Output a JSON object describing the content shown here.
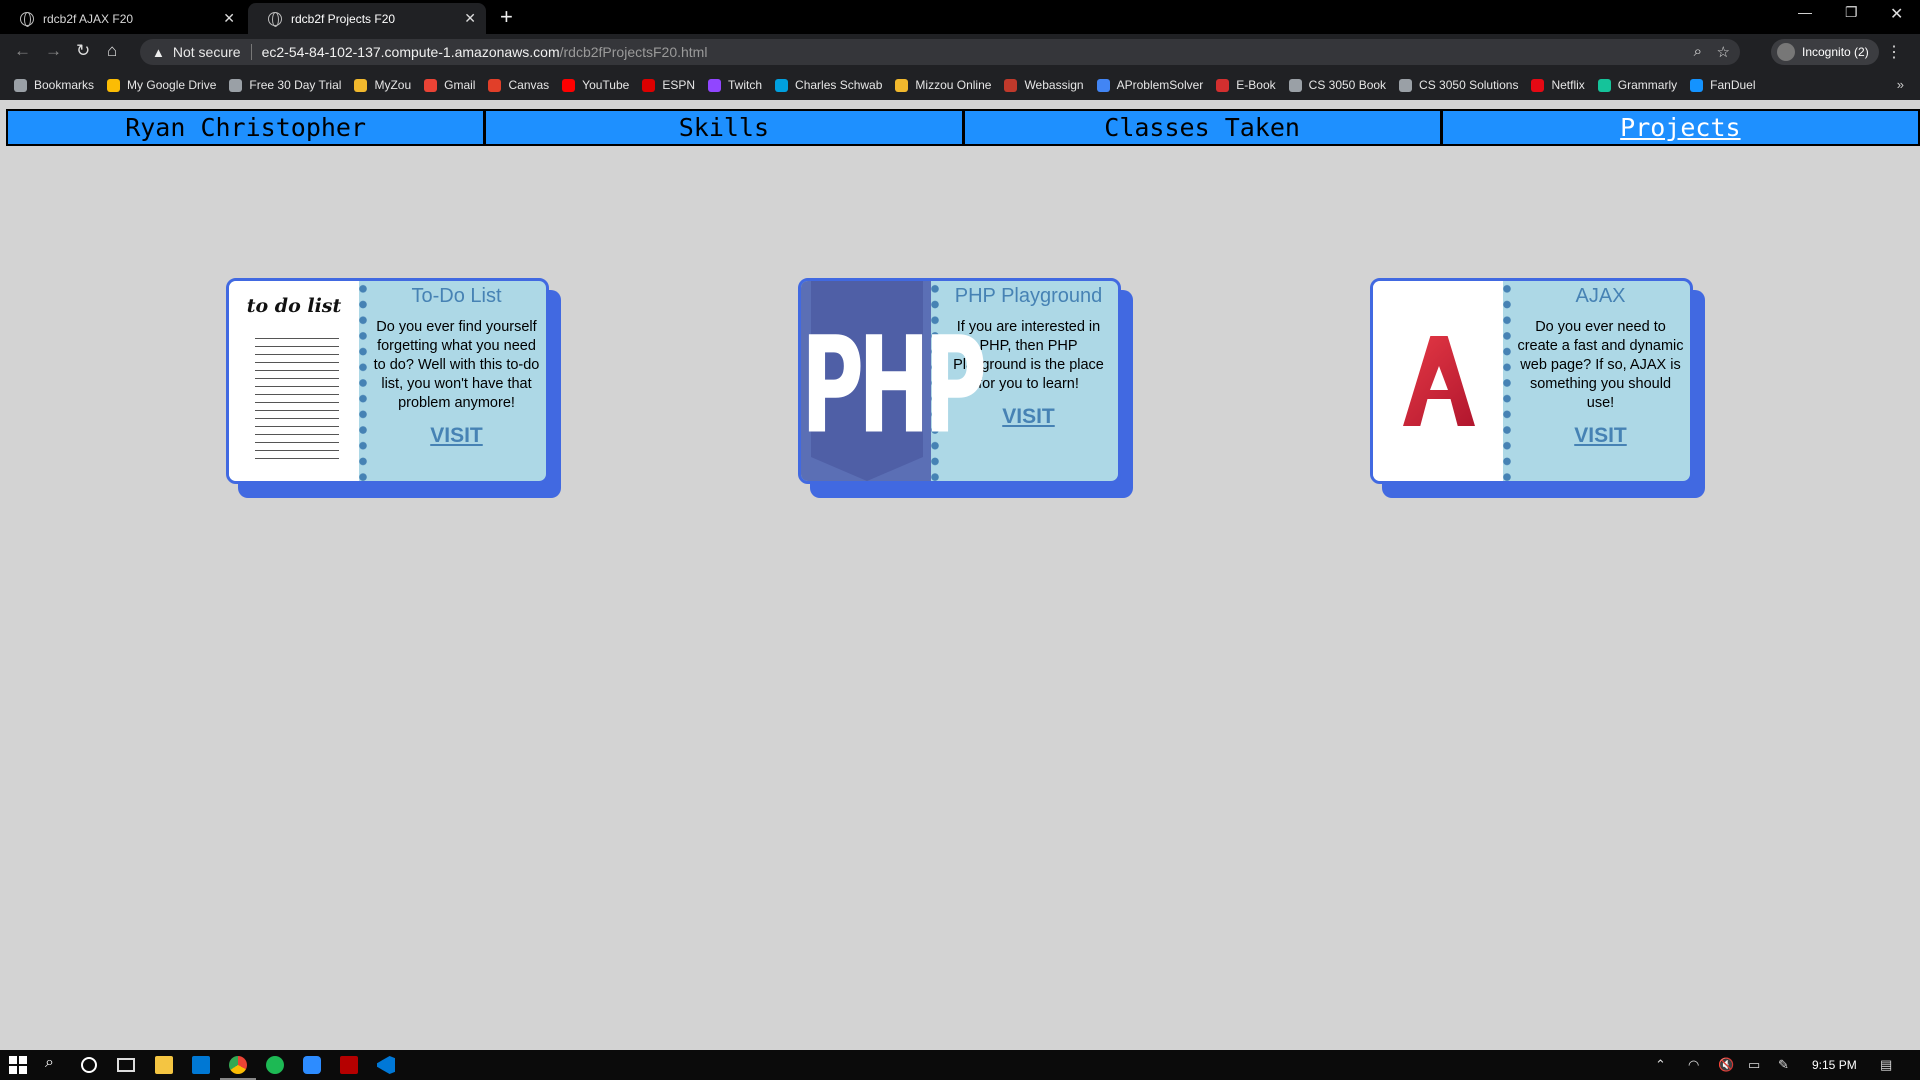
{
  "browser": {
    "tabs": [
      {
        "label": "rdcb2f AJAX F20",
        "active": false
      },
      {
        "label": "rdcb2f Projects F20",
        "active": true
      }
    ],
    "security_label": "Not secure",
    "url_host": "ec2-54-84-102-137.compute-1.amazonaws.com",
    "url_path": "/rdcb2fProjectsF20.html",
    "profile_label": "Incognito (2)",
    "bookmarks": [
      {
        "label": "Bookmarks",
        "icon": "star-icon",
        "color": "#9aa0a6"
      },
      {
        "label": "My Google Drive",
        "icon": "drive-icon",
        "color": "#fbbc04"
      },
      {
        "label": "Free 30 Day Trial",
        "icon": "globe-icon",
        "color": "#9aa0a6"
      },
      {
        "label": "MyZou",
        "icon": "myzou-icon",
        "color": "#f1b82d"
      },
      {
        "label": "Gmail",
        "icon": "gmail-icon",
        "color": "#ea4335"
      },
      {
        "label": "Canvas",
        "icon": "canvas-icon",
        "color": "#e13f29"
      },
      {
        "label": "YouTube",
        "icon": "youtube-icon",
        "color": "#ff0000"
      },
      {
        "label": "ESPN",
        "icon": "espn-icon",
        "color": "#d00"
      },
      {
        "label": "Twitch",
        "icon": "twitch-icon",
        "color": "#9146ff"
      },
      {
        "label": "Charles Schwab",
        "icon": "schwab-icon",
        "color": "#00a0df"
      },
      {
        "label": "Mizzou Online",
        "icon": "mizzou-icon",
        "color": "#f1b82d"
      },
      {
        "label": "Webassign",
        "icon": "webassign-icon",
        "color": "#c0392b"
      },
      {
        "label": "AProblemSolver",
        "icon": "aproblemsolver-icon",
        "color": "#4285f4"
      },
      {
        "label": "E-Book",
        "icon": "ebook-icon",
        "color": "#d32f2f"
      },
      {
        "label": "CS 3050 Book",
        "icon": "globe-icon",
        "color": "#9aa0a6"
      },
      {
        "label": "CS 3050 Solutions",
        "icon": "wordpress-icon",
        "color": "#9aa0a6"
      },
      {
        "label": "Netflix",
        "icon": "netflix-icon",
        "color": "#e50914"
      },
      {
        "label": "Grammarly",
        "icon": "grammarly-icon",
        "color": "#15c39a"
      },
      {
        "label": "FanDuel",
        "icon": "fanduel-icon",
        "color": "#1493ff"
      }
    ]
  },
  "nav": {
    "items": [
      {
        "label": "Ryan Christopher",
        "active": false
      },
      {
        "label": "Skills",
        "active": false
      },
      {
        "label": "Classes Taken",
        "active": false
      },
      {
        "label": "Projects",
        "active": true
      }
    ]
  },
  "projects": [
    {
      "title": "To-Do List",
      "description": "Do you ever find yourself forgetting what you need to do? Well with this to-do list, you won't have that problem anymore!",
      "visit_label": "VISIT",
      "image_label": "to do list"
    },
    {
      "title": "PHP Playground",
      "description": "If you are interested in PHP, then PHP Playground is the place for you to learn!",
      "visit_label": "VISIT",
      "image_label": "PHP"
    },
    {
      "title": "AJAX",
      "description": "Do you ever need to create a fast and dynamic web page? If so, AJAX is something you should use!",
      "visit_label": "VISIT",
      "image_label": ""
    }
  ],
  "taskbar": {
    "clock": "9:15 PM"
  },
  "colors": {
    "page_bg": "#d3d3d3",
    "nav_bg": "#1e90ff",
    "card_bg": "#add8e6",
    "card_border": "#4169e1",
    "accent_text": "#4682b4"
  }
}
